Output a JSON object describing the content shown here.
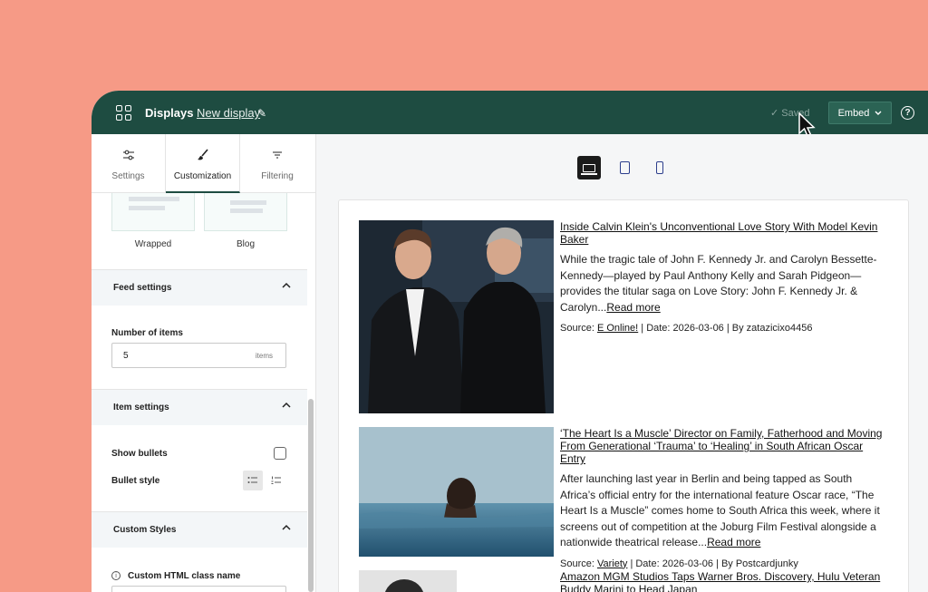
{
  "header": {
    "app_title": "Displays",
    "display_name": "New display",
    "saved_label": "Saved",
    "embed_label": "Embed",
    "help_label": "?"
  },
  "tabs": [
    {
      "label": "Settings",
      "icon": "sliders-icon"
    },
    {
      "label": "Customization",
      "icon": "brush-icon"
    },
    {
      "label": "Filtering",
      "icon": "filter-icon"
    }
  ],
  "layouts": [
    "Wrapped",
    "Blog"
  ],
  "feed_settings": {
    "title": "Feed settings",
    "number_label": "Number of items",
    "number_value": "5",
    "number_unit": "items"
  },
  "item_settings": {
    "title": "Item settings",
    "show_bullets_label": "Show bullets",
    "bullet_style_label": "Bullet style"
  },
  "custom_styles": {
    "title": "Custom Styles",
    "class_label": "Custom HTML class name"
  },
  "feed_items": [
    {
      "title": "Inside Calvin Klein's Unconventional Love Story With Model Kevin Baker",
      "desc": "While the tragic tale of John F. Kennedy Jr. and Carolyn Bessette-Kennedy—played by Paul Anthony Kelly and Sarah Pidgeon—provides the titular saga on Love Story: John F. Kennedy Jr. & Carolyn...",
      "read_more": "Read more",
      "source_prefix": "Source: ",
      "source": "E Online!",
      "meta": " | Date: 2026-03-06 | By zatazicixo4456"
    },
    {
      "title": "‘The Heart Is a Muscle’ Director on Family, Fatherhood and Moving From Generational ‘Trauma’ to ‘Healing’ in South African Oscar Entry",
      "desc": "After launching last year in Berlin and being tapped as South Africa’s official entry for the international feature Oscar race, “The Heart Is a Muscle” comes home to South Africa this week, where it screens out of competition at the Joburg Film Festival alongside a nationwide theatrical release...",
      "read_more": "Read more",
      "source_prefix": "Source: ",
      "source": "Variety",
      "meta": " | Date: 2026-03-06 | By Postcardjunky"
    },
    {
      "title": "Amazon MGM Studios Taps Warner Bros. Discovery, Hulu Veteran Buddy Marini to Head Japan"
    }
  ],
  "colors": {
    "background": "#f69a86",
    "header": "#1e4c41",
    "embed_button": "#2b6354"
  }
}
